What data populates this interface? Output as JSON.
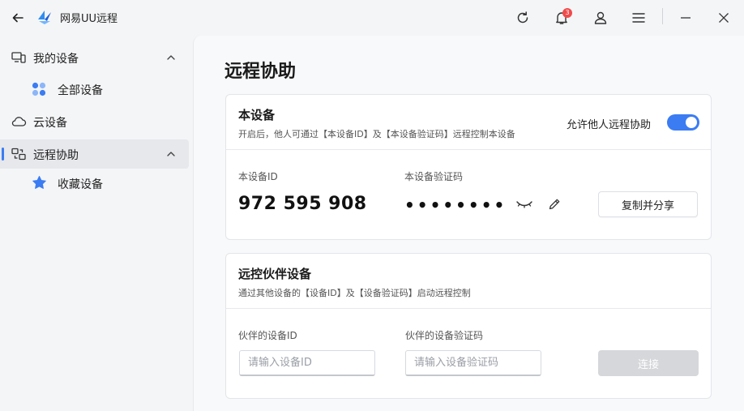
{
  "titlebar": {
    "back_icon": "arrow-left-icon",
    "app_name": "网易UU远程",
    "notification_count": "3",
    "icons": [
      "refresh-icon",
      "bell-icon",
      "user-icon",
      "menu-icon",
      "minimize-icon",
      "close-icon"
    ]
  },
  "sidebar": {
    "items": [
      {
        "label": "我的设备",
        "icon": "devices-icon",
        "expanded": true
      },
      {
        "label": "全部设备",
        "icon": "grid-icon"
      },
      {
        "label": "云设备",
        "icon": "cloud-icon"
      },
      {
        "label": "远程协助",
        "icon": "remote-icon",
        "expanded": true,
        "active": true
      },
      {
        "label": "收藏设备",
        "icon": "star-icon"
      }
    ]
  },
  "main": {
    "title": "远程协助",
    "this_device": {
      "title": "本设备",
      "subtitle": "开启后，他人可通过【本设备ID】及【本设备验证码】远程控制本设备",
      "toggle_label": "允许他人远程协助",
      "toggle_on": true,
      "id_label": "本设备ID",
      "id_value": "972 595 908",
      "code_label": "本设备验证码",
      "code_value": "••••••••",
      "copy_button": "复制并分享"
    },
    "partner": {
      "title": "远控伙伴设备",
      "subtitle": "通过其他设备的【设备ID】及【设备验证码】启动远程控制",
      "id_label": "伙伴的设备ID",
      "id_placeholder": "请输入设备ID",
      "code_label": "伙伴的设备验证码",
      "code_placeholder": "请输入设备验证码",
      "connect_button": "连接"
    }
  },
  "colors": {
    "accent": "#3b7cf3",
    "badge": "#f04a4a",
    "disabled": "#d5d7da"
  }
}
